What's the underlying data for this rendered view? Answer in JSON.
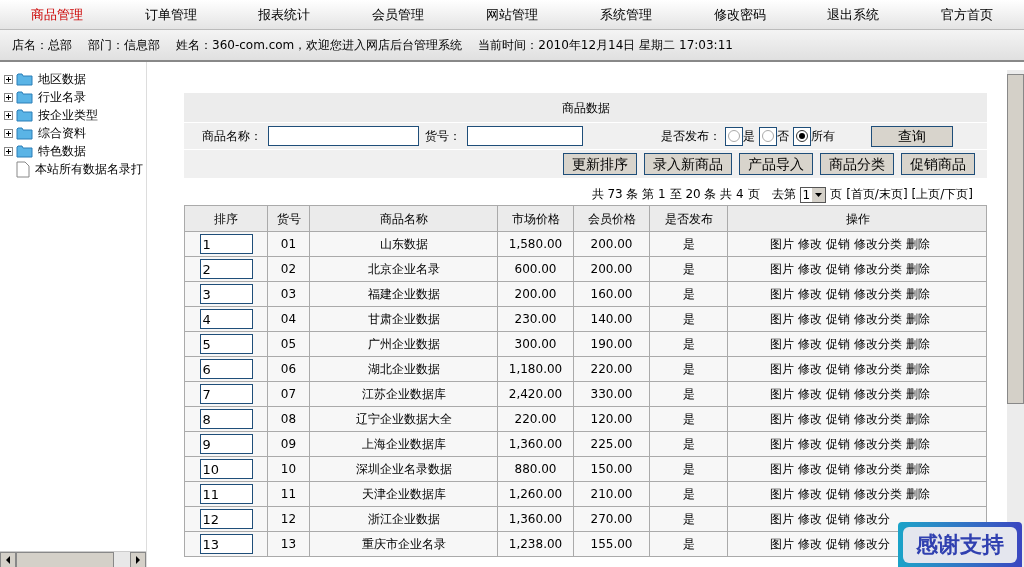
{
  "nav": [
    {
      "label": "商品管理",
      "selected": true
    },
    {
      "label": "订单管理",
      "selected": false
    },
    {
      "label": "报表统计",
      "selected": false
    },
    {
      "label": "会员管理",
      "selected": false
    },
    {
      "label": "网站管理",
      "selected": false
    },
    {
      "label": "系统管理",
      "selected": false
    },
    {
      "label": "修改密码",
      "selected": false
    },
    {
      "label": "退出系统",
      "selected": false
    },
    {
      "label": "官方首页",
      "selected": false
    }
  ],
  "info": [
    "店名：总部",
    "部门：信息部",
    "姓名：360-com.com，欢迎您进入网店后台管理系统",
    "当前时间：2010年12月14日 星期二 17:03:11"
  ],
  "tree": [
    {
      "label": "地区数据",
      "kind": "folder"
    },
    {
      "label": "行业名录",
      "kind": "folder"
    },
    {
      "label": "按企业类型",
      "kind": "folder"
    },
    {
      "label": "综合资料",
      "kind": "folder"
    },
    {
      "label": "特色数据",
      "kind": "folder"
    },
    {
      "label": "本站所有数据名录打",
      "kind": "file"
    }
  ],
  "panel": {
    "title": "商品数据",
    "name_label": "商品名称：",
    "code_label": "货号：",
    "publish_label": "是否发布：",
    "publish_options": [
      {
        "label": "是",
        "selected": false
      },
      {
        "label": "否",
        "selected": false
      },
      {
        "label": "所有",
        "selected": true
      }
    ],
    "query_button": "查询",
    "buttons": [
      "更新排序",
      "录入新商品",
      "产品导入",
      "商品分类",
      "促销商品"
    ]
  },
  "pagination": {
    "summary": "共 73 条 第 1 至 20 条 共 4 页",
    "goto": "去第",
    "page": "1",
    "page_suffix": "页",
    "links": [
      "[首页/末页]",
      "[上页/下页]"
    ]
  },
  "table": {
    "columns": [
      "排序",
      "货号",
      "商品名称",
      "市场价格",
      "会员价格",
      "是否发布",
      "操作"
    ],
    "rows": [
      {
        "order": "1",
        "code": "01",
        "name": "山东数据",
        "market": "1,580.00",
        "member": "200.00",
        "published": "是",
        "actions": [
          "图片",
          "修改",
          "促销",
          "修改分类",
          "删除"
        ]
      },
      {
        "order": "2",
        "code": "02",
        "name": "北京企业名录",
        "market": "600.00",
        "member": "200.00",
        "published": "是",
        "actions": [
          "图片",
          "修改",
          "促销",
          "修改分类",
          "删除"
        ]
      },
      {
        "order": "3",
        "code": "03",
        "name": "福建企业数据",
        "market": "200.00",
        "member": "160.00",
        "published": "是",
        "actions": [
          "图片",
          "修改",
          "促销",
          "修改分类",
          "删除"
        ]
      },
      {
        "order": "4",
        "code": "04",
        "name": "甘肃企业数据",
        "market": "230.00",
        "member": "140.00",
        "published": "是",
        "actions": [
          "图片",
          "修改",
          "促销",
          "修改分类",
          "删除"
        ]
      },
      {
        "order": "5",
        "code": "05",
        "name": "广州企业数据",
        "market": "300.00",
        "member": "190.00",
        "published": "是",
        "actions": [
          "图片",
          "修改",
          "促销",
          "修改分类",
          "删除"
        ]
      },
      {
        "order": "6",
        "code": "06",
        "name": "湖北企业数据",
        "market": "1,180.00",
        "member": "220.00",
        "published": "是",
        "actions": [
          "图片",
          "修改",
          "促销",
          "修改分类",
          "删除"
        ]
      },
      {
        "order": "7",
        "code": "07",
        "name": "江苏企业数据库",
        "market": "2,420.00",
        "member": "330.00",
        "published": "是",
        "actions": [
          "图片",
          "修改",
          "促销",
          "修改分类",
          "删除"
        ]
      },
      {
        "order": "8",
        "code": "08",
        "name": "辽宁企业数据大全",
        "market": "220.00",
        "member": "120.00",
        "published": "是",
        "actions": [
          "图片",
          "修改",
          "促销",
          "修改分类",
          "删除"
        ]
      },
      {
        "order": "9",
        "code": "09",
        "name": "上海企业数据库",
        "market": "1,360.00",
        "member": "225.00",
        "published": "是",
        "actions": [
          "图片",
          "修改",
          "促销",
          "修改分类",
          "删除"
        ]
      },
      {
        "order": "10",
        "code": "10",
        "name": "深圳企业名录数据",
        "market": "880.00",
        "member": "150.00",
        "published": "是",
        "actions": [
          "图片",
          "修改",
          "促销",
          "修改分类",
          "删除"
        ]
      },
      {
        "order": "11",
        "code": "11",
        "name": "天津企业数据库",
        "market": "1,260.00",
        "member": "210.00",
        "published": "是",
        "actions": [
          "图片",
          "修改",
          "促销",
          "修改分类",
          "删除"
        ]
      },
      {
        "order": "12",
        "code": "12",
        "name": "浙江企业数据",
        "market": "1,360.00",
        "member": "270.00",
        "published": "是",
        "actions": [
          "图片",
          "修改",
          "促销",
          "修改分"
        ]
      },
      {
        "order": "13",
        "code": "13",
        "name": "重庆市企业名录",
        "market": "1,238.00",
        "member": "155.00",
        "published": "是",
        "actions": [
          "图片",
          "修改",
          "促销",
          "修改分"
        ]
      }
    ]
  },
  "badge": "感谢支持"
}
